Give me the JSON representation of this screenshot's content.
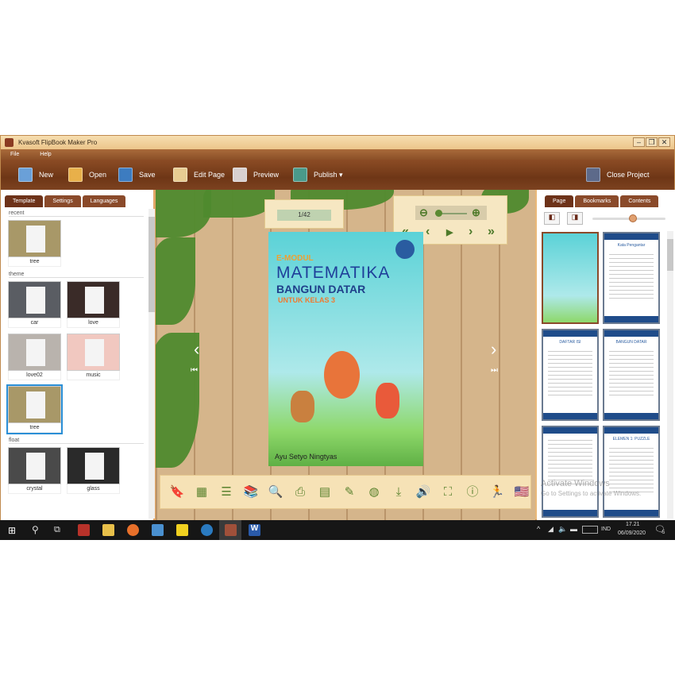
{
  "window": {
    "title": "Kvasoft FlipBook Maker Pro",
    "min": "–",
    "restore": "❐",
    "close": "✕"
  },
  "menu": [
    "File",
    "Help"
  ],
  "toolbar": {
    "new": "New",
    "open": "Open",
    "save": "Save",
    "edit_page": "Edit Page",
    "preview": "Preview",
    "publish": "Publish",
    "publish_arrow": "▾",
    "close_project": "Close Project"
  },
  "left_panel": {
    "tabs": [
      "Template",
      "Settings",
      "Languages"
    ],
    "sections": [
      {
        "title": "recent",
        "items": [
          {
            "label": "tree",
            "bg": "#a89868"
          }
        ]
      },
      {
        "title": "theme",
        "items": [
          {
            "label": "car",
            "bg": "#5a5d63"
          },
          {
            "label": "love",
            "bg": "#3a2b28"
          },
          {
            "label": "love02",
            "bg": "#b9b3ad"
          },
          {
            "label": "music",
            "bg": "#f1c8c0"
          },
          {
            "label": "tree",
            "bg": "#a89868",
            "selected": true
          }
        ]
      },
      {
        "title": "float",
        "items": [
          {
            "label": "crystal",
            "bg": "#4a4a4a"
          },
          {
            "label": "glass",
            "bg": "#2a2a2a"
          }
        ]
      }
    ]
  },
  "viewer": {
    "page_indicator": "1/42",
    "nav": {
      "zoom_out": "⊖",
      "zoom_in": "⊕",
      "first": "«",
      "prev": "‹",
      "play": "▶",
      "next": "›",
      "last": "»"
    },
    "cover": {
      "line1": "E-MODUL",
      "line2": "MATEMATIKA",
      "line3": "BANGUN DATAR",
      "line4": "UNTUK KELAS 3",
      "author": "Ayu Setyo Ningtyas"
    },
    "bottom_tools": [
      {
        "name": "bookmark-icon",
        "glyph": "🔖"
      },
      {
        "name": "thumbnails-grid-icon",
        "glyph": "▦"
      },
      {
        "name": "table-of-contents-icon",
        "glyph": "☰"
      },
      {
        "name": "bookshelf-icon",
        "glyph": "📚"
      },
      {
        "name": "search-icon",
        "glyph": "🔍"
      },
      {
        "name": "print-icon",
        "glyph": "⎙"
      },
      {
        "name": "notes-icon",
        "glyph": "▤"
      },
      {
        "name": "pencil-icon",
        "glyph": "✎"
      },
      {
        "name": "globe-icon",
        "glyph": "◍"
      },
      {
        "name": "download-icon",
        "glyph": "⤓"
      },
      {
        "name": "sound-icon",
        "glyph": "🔊"
      },
      {
        "name": "fullscreen-icon",
        "glyph": "⛶"
      },
      {
        "name": "info-icon",
        "glyph": "ⓘ"
      },
      {
        "name": "autoflip-icon",
        "glyph": "🏃"
      },
      {
        "name": "language-flag-icon",
        "glyph": "🇺🇸"
      }
    ]
  },
  "right_panel": {
    "tabs": [
      "Page",
      "Bookmarks",
      "Contents"
    ],
    "page_titles": [
      "",
      "Kata Pengantar",
      "DAFTAR ISI",
      "BANGUN DATAR",
      "",
      "ELEMEN 1: PUZZLE"
    ],
    "slider_value": 0.55
  },
  "watermark": {
    "line1": "Activate Windows",
    "line2": "Go to Settings to activate Windows."
  },
  "taskbar": {
    "language": "IND",
    "time": "17.21",
    "date": "06/09/2020",
    "notification_count": "5"
  }
}
